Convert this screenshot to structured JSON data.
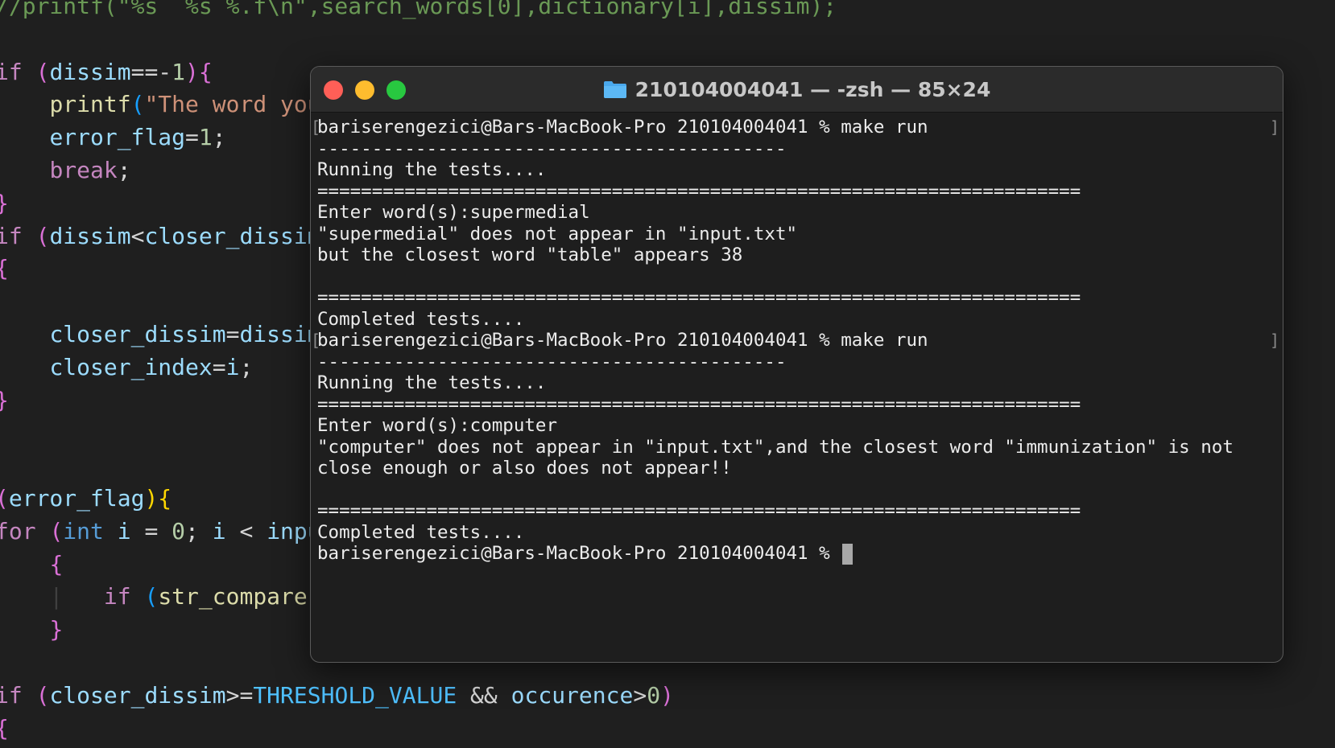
{
  "editor": {
    "lines": [
      {
        "indent": "",
        "tokens": [
          {
            "t": "//printf(\"%s  %s %.f\\n\",search_words[0],dictionary[i],dissim);",
            "c": "c-comment"
          }
        ]
      },
      {
        "indent": "",
        "tokens": []
      },
      {
        "indent": "",
        "tokens": [
          {
            "t": "if ",
            "c": "c-kw"
          },
          {
            "t": "(",
            "c": "c-b1"
          },
          {
            "t": "dissim",
            "c": "c-var"
          },
          {
            "t": "==-",
            "c": "c-op"
          },
          {
            "t": "1",
            "c": "c-num"
          },
          {
            "t": ")",
            "c": "c-b1"
          },
          {
            "t": "{",
            "c": "c-b1"
          }
        ]
      },
      {
        "indent": "    ",
        "tokens": [
          {
            "t": "printf",
            "c": "c-fn"
          },
          {
            "t": "(",
            "c": "c-b3"
          },
          {
            "t": "\"The word you",
            "c": "c-str"
          }
        ]
      },
      {
        "indent": "    ",
        "tokens": [
          {
            "t": "error_flag",
            "c": "c-var"
          },
          {
            "t": "=",
            "c": "c-op"
          },
          {
            "t": "1",
            "c": "c-num"
          },
          {
            "t": ";",
            "c": "c-op"
          }
        ]
      },
      {
        "indent": "    ",
        "tokens": [
          {
            "t": "break",
            "c": "c-kw"
          },
          {
            "t": ";",
            "c": "c-op"
          }
        ]
      },
      {
        "indent": "",
        "tokens": [
          {
            "t": "}",
            "c": "c-b1"
          }
        ]
      },
      {
        "indent": "",
        "tokens": [
          {
            "t": "if ",
            "c": "c-kw"
          },
          {
            "t": "(",
            "c": "c-b1"
          },
          {
            "t": "dissim",
            "c": "c-var"
          },
          {
            "t": "<",
            "c": "c-op"
          },
          {
            "t": "closer_dissim",
            "c": "c-var"
          }
        ]
      },
      {
        "indent": "",
        "tokens": [
          {
            "t": "{",
            "c": "c-b1"
          }
        ]
      },
      {
        "indent": "",
        "tokens": []
      },
      {
        "indent": "    ",
        "tokens": [
          {
            "t": "closer_dissim",
            "c": "c-var"
          },
          {
            "t": "=",
            "c": "c-op"
          },
          {
            "t": "dissim",
            "c": "c-var"
          }
        ]
      },
      {
        "indent": "    ",
        "tokens": [
          {
            "t": "closer_index",
            "c": "c-var"
          },
          {
            "t": "=",
            "c": "c-op"
          },
          {
            "t": "i",
            "c": "c-var"
          },
          {
            "t": ";",
            "c": "c-op"
          }
        ]
      },
      {
        "indent": "",
        "tokens": [
          {
            "t": "}",
            "c": "c-b1"
          }
        ]
      },
      {
        "indent": "",
        "tokens": []
      },
      {
        "indent": "",
        "tokens": []
      },
      {
        "indent": "",
        "tokens": [
          {
            "t": "(",
            "c": "c-b1"
          },
          {
            "t": "error_flag",
            "c": "c-var"
          },
          {
            "t": ")",
            "c": "c-b2"
          },
          {
            "t": "{",
            "c": "c-b2"
          }
        ]
      },
      {
        "indent": "",
        "tokens": [
          {
            "t": "for ",
            "c": "c-kw"
          },
          {
            "t": "(",
            "c": "c-b1"
          },
          {
            "t": "int",
            "c": "c-type"
          },
          {
            "t": " i ",
            "c": "c-var"
          },
          {
            "t": "= ",
            "c": "c-op"
          },
          {
            "t": "0",
            "c": "c-num"
          },
          {
            "t": "; ",
            "c": "c-op"
          },
          {
            "t": "i ",
            "c": "c-var"
          },
          {
            "t": "< ",
            "c": "c-op"
          },
          {
            "t": "input",
            "c": "c-var"
          }
        ]
      },
      {
        "indent": "    ",
        "tokens": [
          {
            "t": "{",
            "c": "c-b1"
          }
        ]
      },
      {
        "indent": "    ",
        "tokens": [
          {
            "t": "|",
            "c": "c-guide"
          },
          {
            "t": "   if ",
            "c": "c-kw"
          },
          {
            "t": "(",
            "c": "c-b3"
          },
          {
            "t": "str_compare",
            "c": "c-fn"
          }
        ]
      },
      {
        "indent": "    ",
        "tokens": [
          {
            "t": "}",
            "c": "c-b1"
          }
        ]
      },
      {
        "indent": "",
        "tokens": []
      },
      {
        "indent": "",
        "tokens": [
          {
            "t": "if ",
            "c": "c-kw"
          },
          {
            "t": "(",
            "c": "c-b1"
          },
          {
            "t": "closer_dissim",
            "c": "c-var"
          },
          {
            "t": ">=",
            "c": "c-op"
          },
          {
            "t": "THRESHOLD_VALUE",
            "c": "c-const"
          },
          {
            "t": " && ",
            "c": "c-op"
          },
          {
            "t": "occurence",
            "c": "c-var"
          },
          {
            "t": ">",
            "c": "c-op"
          },
          {
            "t": "0",
            "c": "c-num"
          },
          {
            "t": ")",
            "c": "c-b1"
          }
        ]
      },
      {
        "indent": "",
        "tokens": [
          {
            "t": "{",
            "c": "c-b1"
          }
        ]
      }
    ]
  },
  "terminal": {
    "title": "210104004041 — -zsh — 85×24",
    "folder_icon": "folder-icon",
    "colors": {
      "close": "#ff5f57",
      "minimize": "#febc2e",
      "maximize": "#28c840"
    },
    "lines": [
      {
        "text": "bariserengezici@Bars-MacBook-Pro 210104004041 % make run",
        "brackets": true
      },
      {
        "text": "-------------------------------------------"
      },
      {
        "text": "Running the tests...."
      },
      {
        "text": "======================================================================"
      },
      {
        "text": "Enter word(s):supermedial"
      },
      {
        "text": "\"supermedial\" does not appear in \"input.txt\""
      },
      {
        "text": "but the closest word \"table\" appears 38"
      },
      {
        "text": ""
      },
      {
        "text": "======================================================================"
      },
      {
        "text": "Completed tests...."
      },
      {
        "text": "bariserengezici@Bars-MacBook-Pro 210104004041 % make run",
        "brackets": true
      },
      {
        "text": "-------------------------------------------"
      },
      {
        "text": "Running the tests...."
      },
      {
        "text": "======================================================================"
      },
      {
        "text": "Enter word(s):computer"
      },
      {
        "text": "\"computer\" does not appear in \"input.txt\",and the closest word \"immunization\" is not"
      },
      {
        "text": "close enough or also does not appear!!"
      },
      {
        "text": ""
      },
      {
        "text": "======================================================================"
      },
      {
        "text": "Completed tests...."
      },
      {
        "text": "bariserengezici@Bars-MacBook-Pro 210104004041 % ",
        "cursor": true
      }
    ]
  }
}
